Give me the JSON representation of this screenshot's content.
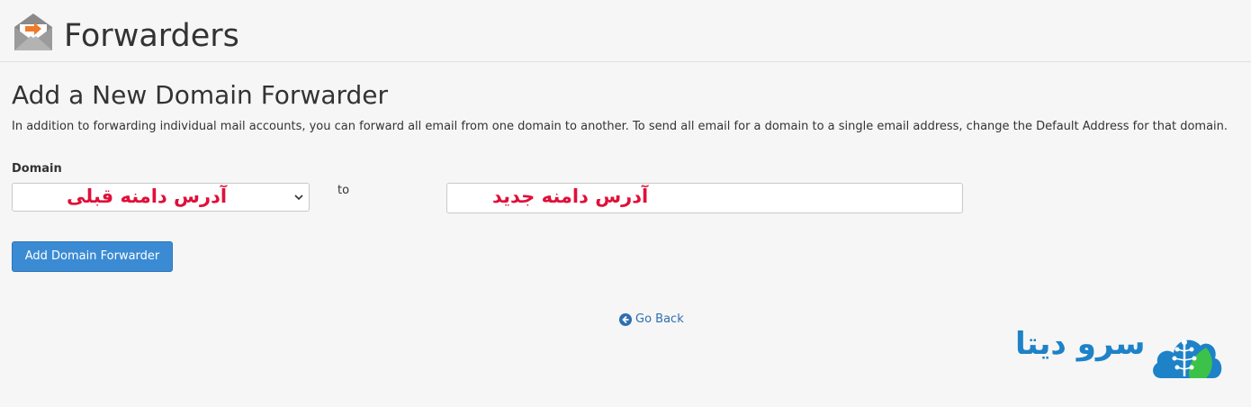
{
  "header": {
    "title": "Forwarders",
    "icon": "mail-forward-icon"
  },
  "section": {
    "title": "Add a New Domain Forwarder",
    "description": "In addition to forwarding individual mail accounts, you can forward all email from one domain to another. To send all email for a domain to a single email address, change the Default Address for that domain."
  },
  "form": {
    "domain_label": "Domain",
    "domain_value_annotation": "آدرس دامنه قبلی",
    "to_label": "to",
    "destination_annotation": "آدرس دامنه جدید",
    "submit_label": "Add Domain Forwarder"
  },
  "nav": {
    "go_back_label": "Go Back"
  },
  "brand": {
    "name": "سرو دیتا"
  },
  "colors": {
    "accent": "#3b8bd4",
    "annotation": "#e0103a",
    "link": "#2f6fb0",
    "brand_blue": "#1d82c8",
    "brand_green": "#3cc24a"
  }
}
